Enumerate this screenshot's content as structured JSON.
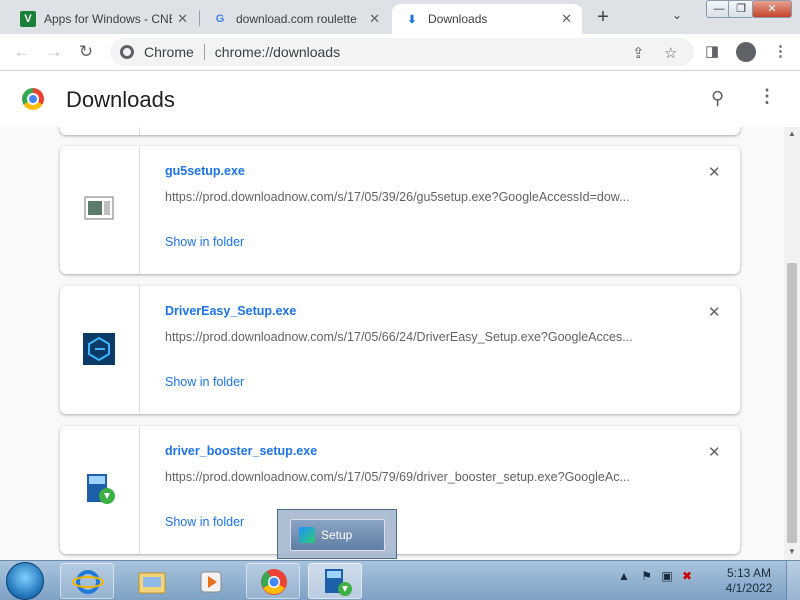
{
  "tabs": [
    {
      "title": "Apps for Windows - CNET",
      "icon": "cnet-icon"
    },
    {
      "title": "download.com roulette",
      "icon": "google-icon"
    },
    {
      "title": "Downloads",
      "icon": "download-icon",
      "active": true
    }
  ],
  "omnibox": {
    "site_label": "Chrome",
    "url": "chrome://downloads"
  },
  "header": {
    "title": "Downloads"
  },
  "downloads": [
    {
      "filename": "gu5setup.exe",
      "url": "https://prod.downloadnow.com/s/17/05/39/26/gu5setup.exe?GoogleAccessId=dow...",
      "action": "Show in folder"
    },
    {
      "filename": "DriverEasy_Setup.exe",
      "url": "https://prod.downloadnow.com/s/17/05/66/24/DriverEasy_Setup.exe?GoogleAcces...",
      "action": "Show in folder"
    },
    {
      "filename": "driver_booster_setup.exe",
      "url": "https://prod.downloadnow.com/s/17/05/79/69/driver_booster_setup.exe?GoogleAc...",
      "action": "Show in folder"
    }
  ],
  "taskbar": {
    "popup_label": "Setup",
    "clock_time": "5:13 AM",
    "clock_date": "4/1/2022"
  },
  "colors": {
    "link": "#1a73e8",
    "accent_tab_icon": "#188038"
  }
}
